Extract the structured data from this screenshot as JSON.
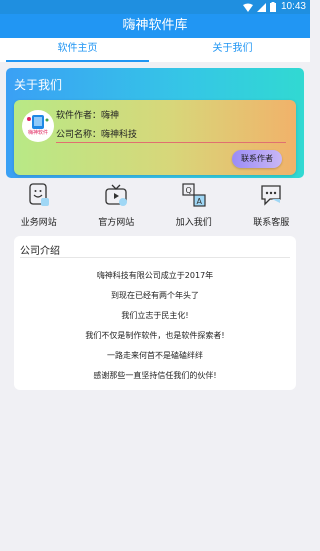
{
  "status_bar": {
    "time": "10:43",
    "icons": [
      "wifi-icon",
      "signal-icon",
      "battery-icon"
    ]
  },
  "app_bar": {
    "title": "嗨神软件库"
  },
  "tabs": [
    {
      "label": "软件主页",
      "active": true
    },
    {
      "label": "关于我们",
      "active": false
    }
  ],
  "header": {
    "title": "关于我们"
  },
  "profile": {
    "logo_text": "嗨神软件",
    "author": "软件作者：嗨神",
    "company": "公司名称：嗨神科技",
    "contact_button": "联系作者"
  },
  "quick_links": [
    {
      "label": "业务网站",
      "icon": "smile-doc-icon"
    },
    {
      "label": "官方网站",
      "icon": "tv-icon"
    },
    {
      "label": "加入我们",
      "icon": "qa-icon"
    },
    {
      "label": "联系客服",
      "icon": "chat-bubble-icon"
    }
  ],
  "intro": {
    "title": "公司介绍",
    "lines": [
      "嗨神科技有限公司成立于2017年",
      "到现在已经有两个年头了",
      "我们立志于民主化!",
      "我们不仅是制作软件，也是软件探索者!",
      "一路走来何首不是磕磕绊绊",
      "感谢那些一直坚持信任我们的伙伴!"
    ]
  },
  "colors": {
    "primary": "#2196f3",
    "status_bar": "#1f8fe0",
    "background": "#f0f0f4"
  }
}
